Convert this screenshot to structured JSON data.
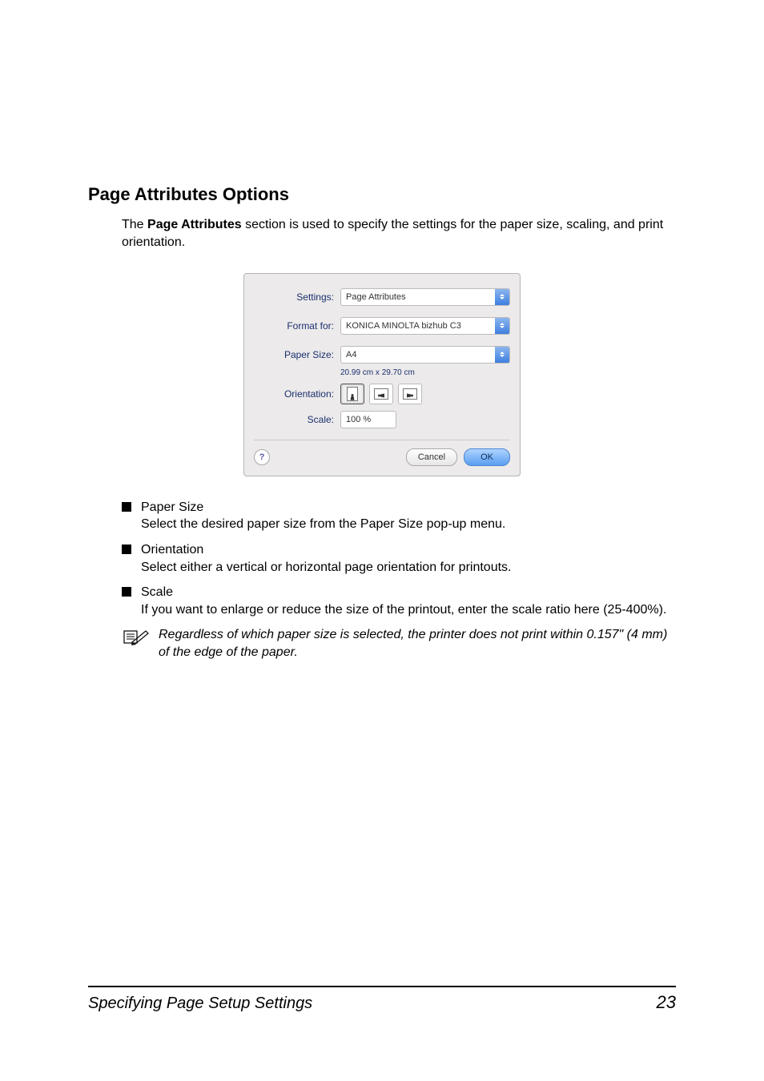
{
  "heading": "Page Attributes Options",
  "intro_prefix": "The ",
  "intro_bold": "Page Attributes",
  "intro_suffix": " section is used to specify the settings for the paper size, scaling, and print orientation.",
  "dialog": {
    "labels": {
      "settings": "Settings:",
      "format_for": "Format for:",
      "paper_size": "Paper Size:",
      "orientation": "Orientation:",
      "scale": "Scale:"
    },
    "values": {
      "settings": "Page Attributes",
      "format_for": "KONICA MINOLTA bizhub C3",
      "paper_size": "A4",
      "dimensions": "20.99 cm x 29.70 cm",
      "scale": "100 %"
    },
    "buttons": {
      "help": "?",
      "cancel": "Cancel",
      "ok": "OK"
    }
  },
  "bullets": [
    {
      "title": "Paper Size",
      "desc": "Select the desired paper size from the Paper Size pop-up menu."
    },
    {
      "title": "Orientation",
      "desc": "Select either a vertical or horizontal page orientation for printouts."
    },
    {
      "title": "Scale",
      "desc": "If you want to enlarge or reduce the size of the printout, enter the scale ratio here (25-400%)."
    }
  ],
  "note": "Regardless of which paper size is selected, the printer does not print within 0.157\" (4 mm) of the edge of the paper.",
  "footer": {
    "title": "Specifying Page Setup Settings",
    "page": "23"
  }
}
